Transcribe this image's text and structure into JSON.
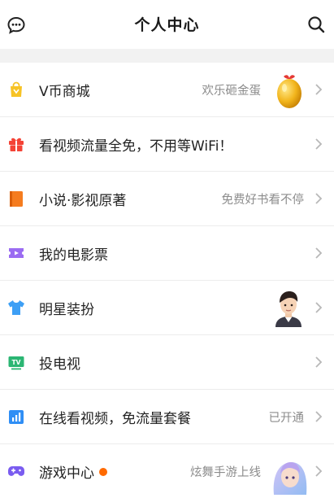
{
  "header": {
    "title": "个人中心",
    "left_icon": "message-bubble-icon",
    "right_icon": "search-icon"
  },
  "rows": [
    {
      "label": "V币商城",
      "sub": "欢乐砸金蛋",
      "icon": "shopping-bag-icon",
      "icon_color": "#f7c325",
      "thumb": "golden-egg"
    },
    {
      "label": "看视频流量全免，不用等WiFi！",
      "sub": "",
      "icon": "gift-icon",
      "icon_color": "#f44336"
    },
    {
      "label": "小说·影视原著",
      "sub": "免费好书看不停",
      "icon": "book-icon",
      "icon_color": "#f57c1f"
    },
    {
      "label": "我的电影票",
      "sub": "",
      "icon": "ticket-icon",
      "icon_color": "#9b6cf2"
    },
    {
      "label": "明星装扮",
      "sub": "",
      "icon": "tshirt-icon",
      "icon_color": "#3d9ff5",
      "thumb": "star-avatar"
    },
    {
      "label": "投电视",
      "sub": "",
      "icon": "tv-icon",
      "icon_color": "#2bb673",
      "icon_text": "TV"
    },
    {
      "label": "在线看视频，免流量套餐",
      "sub": "已开通",
      "icon": "data-plan-icon",
      "icon_color": "#2f8ef5"
    },
    {
      "label": "游戏中心",
      "sub": "炫舞手游上线",
      "icon": "gamepad-icon",
      "icon_color": "#7a5cf0",
      "badge": "new-dot",
      "thumb": "game-character"
    }
  ]
}
